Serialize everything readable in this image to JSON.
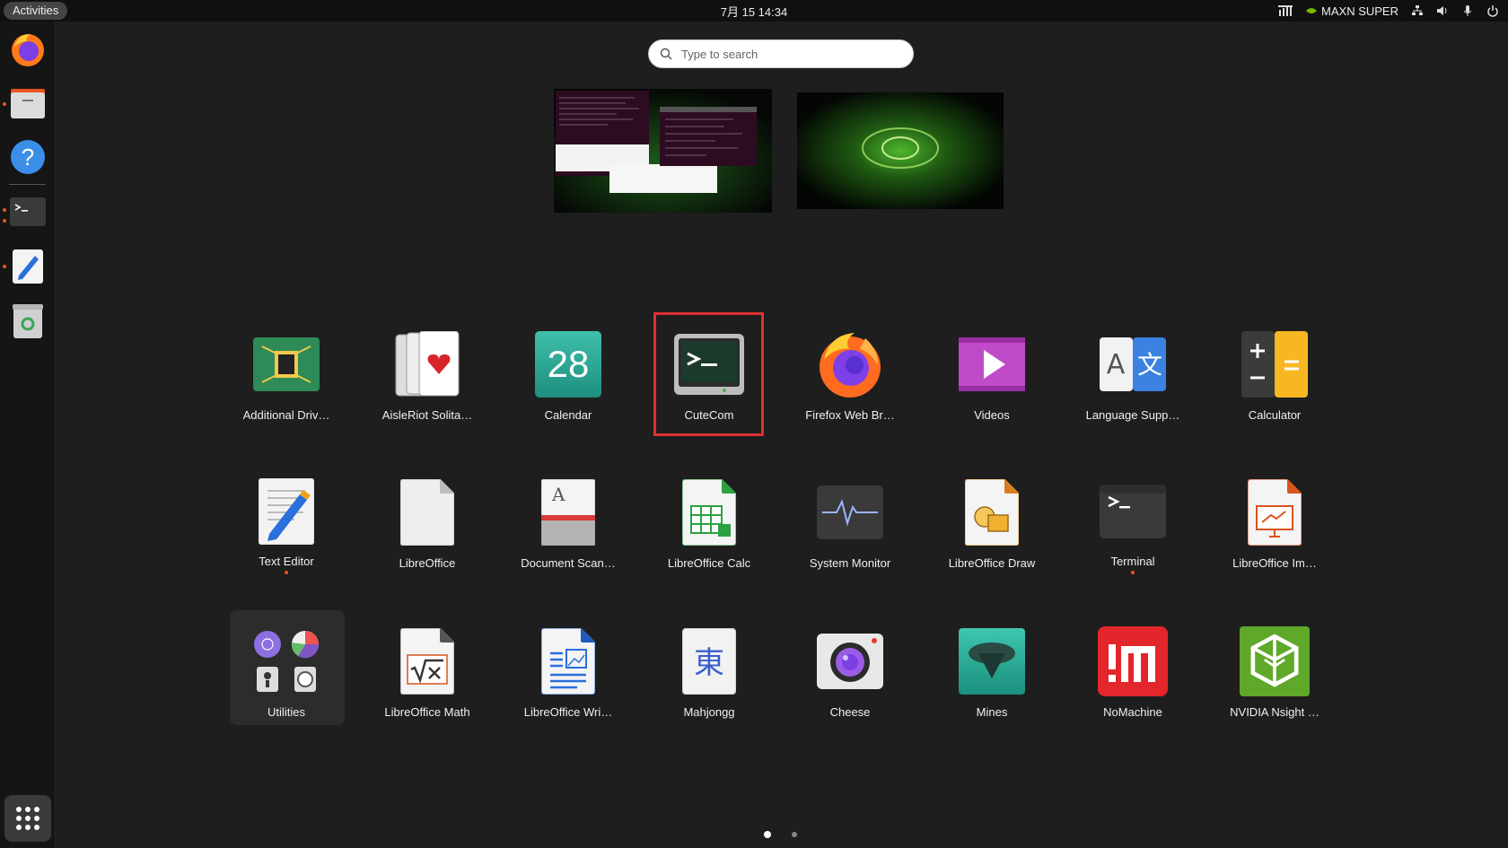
{
  "topbar": {
    "activities": "Activities",
    "clock": "7月 15  14:34",
    "power_mode": "MAXN SUPER"
  },
  "search": {
    "placeholder": "Type to search"
  },
  "dock": {
    "items": [
      {
        "name": "firefox",
        "running": false
      },
      {
        "name": "files",
        "running": true
      },
      {
        "name": "help",
        "running": false
      },
      {
        "name": "terminal",
        "running": true
      },
      {
        "name": "text-editor",
        "running": true
      },
      {
        "name": "trash",
        "running": false
      }
    ]
  },
  "apps": [
    {
      "label": "Additional Driv…",
      "icon": "chip-icon"
    },
    {
      "label": "AisleRiot Solita…",
      "icon": "cards-icon"
    },
    {
      "label": "Calendar",
      "icon": "calendar-icon",
      "day": "28"
    },
    {
      "label": "CuteCom",
      "icon": "cutecom-icon"
    },
    {
      "label": "Firefox Web Br…",
      "icon": "firefox-icon"
    },
    {
      "label": "Videos",
      "icon": "play-icon"
    },
    {
      "label": "Language Supp…",
      "icon": "language-icon"
    },
    {
      "label": "Calculator",
      "icon": "calculator-icon"
    },
    {
      "label": "Text Editor",
      "icon": "text-editor-icon",
      "running": true
    },
    {
      "label": "LibreOffice",
      "icon": "libreoffice-icon"
    },
    {
      "label": "Document Scan…",
      "icon": "scanner-icon"
    },
    {
      "label": "LibreOffice Calc",
      "icon": "spreadsheet-icon"
    },
    {
      "label": "System Monitor",
      "icon": "system-monitor-icon"
    },
    {
      "label": "LibreOffice Draw",
      "icon": "draw-icon"
    },
    {
      "label": "Terminal",
      "icon": "terminal-icon",
      "running": true
    },
    {
      "label": "LibreOffice Im…",
      "icon": "impress-icon"
    },
    {
      "label": "Utilities",
      "icon": "folder-icon"
    },
    {
      "label": "LibreOffice Math",
      "icon": "math-icon"
    },
    {
      "label": "LibreOffice Wri…",
      "icon": "writer-icon"
    },
    {
      "label": "Mahjongg",
      "icon": "mahjongg-icon",
      "glyph": "東"
    },
    {
      "label": "Cheese",
      "icon": "camera-icon"
    },
    {
      "label": "Mines",
      "icon": "mines-icon"
    },
    {
      "label": "NoMachine",
      "icon": "nomachine-icon"
    },
    {
      "label": "NVIDIA Nsight …",
      "icon": "nsight-icon"
    }
  ],
  "calendar_glyph": "28",
  "language_glyphs": {
    "left": "A",
    "right": "文"
  },
  "scanner_glyph": "A",
  "pager": {
    "current": 1,
    "total": 2
  },
  "colors": {
    "accent": "#e95420",
    "highlight": "#e03030"
  }
}
